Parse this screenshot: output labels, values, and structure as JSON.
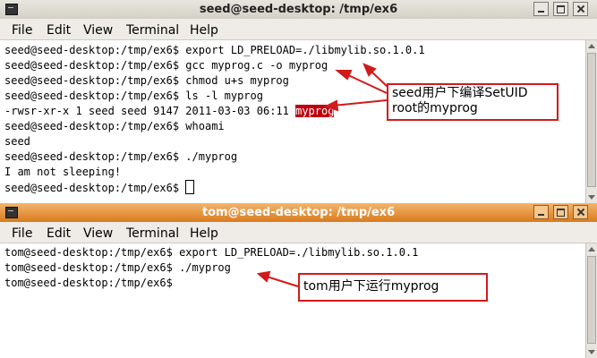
{
  "menu": [
    "File",
    "Edit",
    "View",
    "Terminal",
    "Help"
  ],
  "windows": {
    "seed": {
      "title": "seed@seed-desktop: /tmp/ex6",
      "lines": [
        "seed@seed-desktop:/tmp/ex6$ export LD_PRELOAD=./libmylib.so.1.0.1",
        "seed@seed-desktop:/tmp/ex6$ gcc myprog.c -o myprog",
        "seed@seed-desktop:/tmp/ex6$ chmod u+s myprog",
        "seed@seed-desktop:/tmp/ex6$ ls -l myprog",
        "-rwsr-xr-x 1 seed seed 9147 2011-03-03 06:11 ",
        "seed@seed-desktop:/tmp/ex6$ whoami",
        "seed",
        "seed@seed-desktop:/tmp/ex6$ ./myprog",
        "I am not sleeping!",
        "seed@seed-desktop:/tmp/ex6$ "
      ],
      "highlighted_file": "myprog"
    },
    "tom": {
      "title": "tom@seed-desktop: /tmp/ex6",
      "lines": [
        "tom@seed-desktop:/tmp/ex6$ export LD_PRELOAD=./libmylib.so.1.0.1",
        "tom@seed-desktop:/tmp/ex6$ ./myprog",
        "tom@seed-desktop:/tmp/ex6$"
      ]
    }
  },
  "annotations": {
    "seed_note": "seed用户下编译SetUID root的myprog",
    "tom_note": "tom用户下运行myprog"
  },
  "colors": {
    "highlight": "#c0000c",
    "annotation": "#d11a1a",
    "active_titlebar": "#e48a2e"
  }
}
